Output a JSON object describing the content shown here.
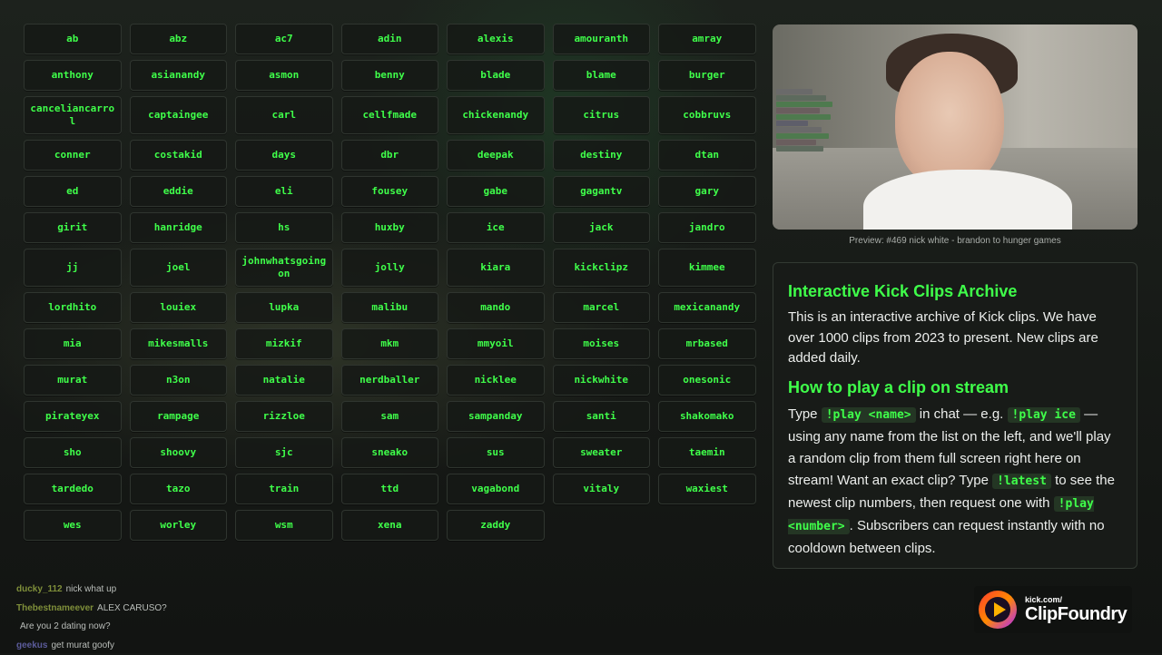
{
  "background_chat": [
    {
      "user": "ducky_112",
      "text": "nick what up"
    },
    {
      "user": "Thebestnameever",
      "text": "ALEX CARUSO?"
    },
    {
      "user": "",
      "text": "Are you 2 dating now?"
    },
    {
      "user": "geekus",
      "text": "get murat goofy"
    }
  ],
  "names": [
    "ab",
    "abz",
    "ac7",
    "adin",
    "alexis",
    "amouranth",
    "amray",
    "anthony",
    "asianandy",
    "asmon",
    "benny",
    "blade",
    "blame",
    "burger",
    "canceliancarrol",
    "captaingee",
    "carl",
    "cellfmade",
    "chickenandy",
    "citrus",
    "cobbruvs",
    "conner",
    "costakid",
    "days",
    "dbr",
    "deepak",
    "destiny",
    "dtan",
    "ed",
    "eddie",
    "eli",
    "fousey",
    "gabe",
    "gagantv",
    "gary",
    "girit",
    "hanridge",
    "hs",
    "huxby",
    "ice",
    "jack",
    "jandro",
    "jj",
    "joel",
    "johnwhatsgoingon",
    "jolly",
    "kiara",
    "kickclipz",
    "kimmee",
    "lordhito",
    "louiex",
    "lupka",
    "malibu",
    "mando",
    "marcel",
    "mexicanandy",
    "mia",
    "mikesmalls",
    "mizkif",
    "mkm",
    "mmyoil",
    "moises",
    "mrbased",
    "murat",
    "n3on",
    "natalie",
    "nerdballer",
    "nicklee",
    "nickwhite",
    "onesonic",
    "pirateyex",
    "rampage",
    "rizzloe",
    "sam",
    "sampanday",
    "santi",
    "shakomako",
    "sho",
    "shoovy",
    "sjc",
    "sneako",
    "sus",
    "sweater",
    "taemin",
    "tardedo",
    "tazo",
    "train",
    "ttd",
    "vagabond",
    "vitaly",
    "waxiest",
    "wes",
    "worley",
    "wsm",
    "xena",
    "zaddy"
  ],
  "preview": {
    "caption": "Preview: #469 nick white - brandon to hunger games"
  },
  "info": {
    "title": "Interactive Kick Clips Archive",
    "intro": "This is an interactive archive of Kick clips. We have over 1000 clips from 2023 to present. New clips are added daily.",
    "howto_title": "How to play a clip on stream",
    "howto": {
      "t1": "Type ",
      "c1": "!play <name>",
      "t2": " in chat — e.g. ",
      "c2": "!play ice",
      "t3": " — using any name from the list on the left, and we'll play a random clip from them full screen right here on stream! Want an exact clip? Type ",
      "c3": "!latest",
      "t4": " to see the newest clip numbers, then request one with ",
      "c4": "!play <number>",
      "t5": ". Subscribers can request instantly with no cooldown between clips."
    }
  },
  "logo": {
    "small": "kick.com/",
    "big": "ClipFoundry"
  },
  "colors": {
    "accent": "#3fff4a",
    "code_bg": "#243624",
    "panel_bg": "#181b18"
  }
}
